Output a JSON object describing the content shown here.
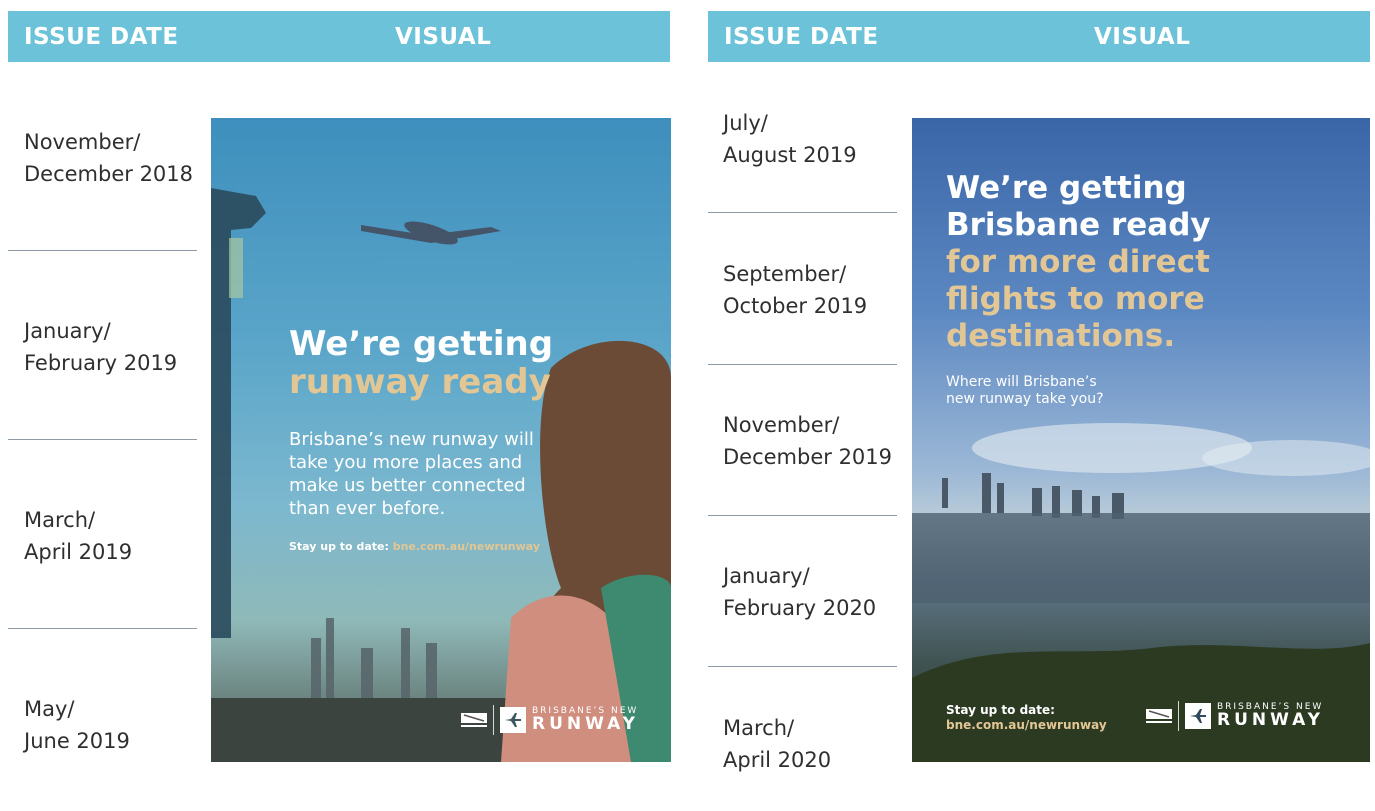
{
  "left_table": {
    "header": {
      "col1": "ISSUE DATE",
      "col2": "VISUAL"
    },
    "dates": [
      [
        "November/",
        "December 2018"
      ],
      [
        "January/",
        "February 2019"
      ],
      [
        "March/",
        "April 2019"
      ],
      [
        "May/",
        "June 2019"
      ]
    ],
    "poster": {
      "headline_white": "We’re getting",
      "headline_gold": "runway ready",
      "body": [
        "Brisbane’s new runway will",
        "take you more places and",
        "make us better connected",
        "than ever before."
      ],
      "cta_label": "Stay up to date:",
      "cta_link": "bne.com.au/newrunway",
      "logo_small": "BRISBANE’S NEW",
      "logo_big": "RUNWAY"
    }
  },
  "right_table": {
    "header": {
      "col1": "ISSUE DATE",
      "col2": "VISUAL"
    },
    "dates": [
      [
        "July/",
        "August 2019"
      ],
      [
        "September/",
        "October 2019"
      ],
      [
        "November/",
        "December 2019"
      ],
      [
        "January/",
        "February 2020"
      ],
      [
        "March/",
        "April 2020"
      ]
    ],
    "poster": {
      "headline_white": [
        "We’re getting",
        "Brisbane ready"
      ],
      "headline_gold": [
        "for more direct",
        "flights to more",
        "destinations."
      ],
      "sub": [
        "Where will Brisbane’s",
        "new runway take you?"
      ],
      "cta_label": "Stay up to date:",
      "cta_link": "bne.com.au/newrunway",
      "logo_small": "BRISBANE’S NEW",
      "logo_big": "RUNWAY"
    }
  },
  "colors": {
    "header_bg": "#6cc2d8",
    "gold": "#e2c795",
    "rule": "#8c9aa6"
  }
}
